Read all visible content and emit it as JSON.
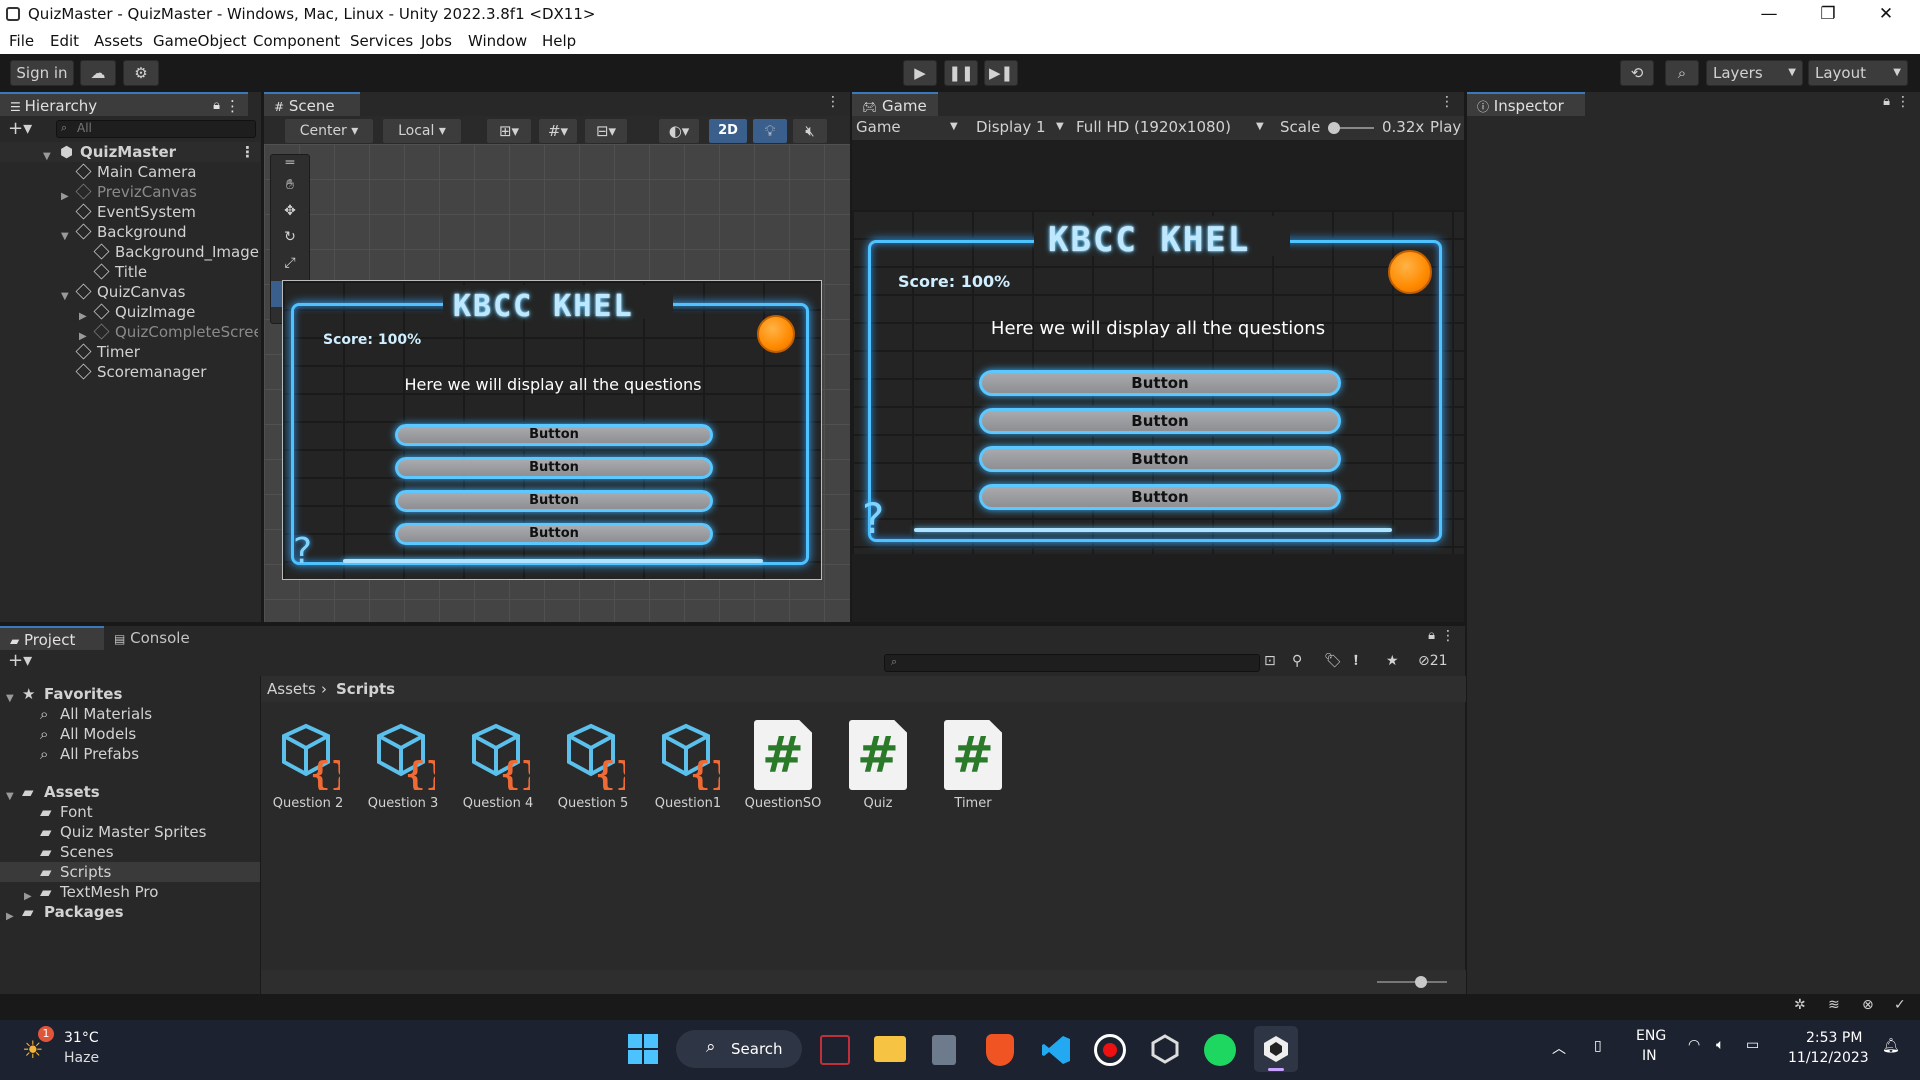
{
  "window": {
    "title": "QuizMaster - QuizMaster - Windows, Mac, Linux - Unity 2022.3.8f1 <DX11>",
    "minimize": "—",
    "restore": "❐",
    "close": "✕"
  },
  "menu": [
    "File",
    "Edit",
    "Assets",
    "GameObject",
    "Component",
    "Services",
    "Jobs",
    "Window",
    "Help"
  ],
  "toolbar": {
    "sign_in": "Sign in",
    "layers": "Layers",
    "layout": "Layout"
  },
  "hierarchy": {
    "tab": "Hierarchy",
    "search_placeholder": "All",
    "scene": "QuizMaster",
    "items": [
      {
        "label": "Main Camera"
      },
      {
        "label": "PrevizCanvas"
      },
      {
        "label": "EventSystem"
      },
      {
        "label": "Background"
      },
      {
        "label": "Background_Image"
      },
      {
        "label": "Title"
      },
      {
        "label": "QuizCanvas"
      },
      {
        "label": "QuizImage"
      },
      {
        "label": "QuizCompleteScree"
      },
      {
        "label": "Timer"
      },
      {
        "label": "Scoremanager"
      }
    ]
  },
  "scene": {
    "tab": "Scene",
    "pivot": "Center",
    "space": "Local",
    "mode2d": "2D"
  },
  "game": {
    "tab": "Game",
    "view": "Game",
    "display": "Display 1",
    "resolution": "Full HD (1920x1080)",
    "scale_label": "Scale",
    "scale_value": "0.32x",
    "play_label": "Play",
    "title": "KBCC KHEL",
    "score": "Score: 100%",
    "question": "Here we will display all the questions",
    "buttons": [
      "Button",
      "Button",
      "Button",
      "Button"
    ],
    "question_mark": "?"
  },
  "inspector": {
    "tab": "Inspector"
  },
  "project": {
    "tab_project": "Project",
    "tab_console": "Console",
    "hidden_count": "21",
    "favorites": "Favorites",
    "fav_items": [
      "All Materials",
      "All Models",
      "All Prefabs"
    ],
    "assets": "Assets",
    "asset_folders": [
      "Font",
      "Quiz Master Sprites",
      "Scenes",
      "Scripts",
      "TextMesh Pro"
    ],
    "packages": "Packages",
    "breadcrumb_root": "Assets",
    "breadcrumb_sep": "›",
    "breadcrumb_current": "Scripts",
    "files": [
      {
        "name": "Question 2",
        "kind": "scriptable-object-icon"
      },
      {
        "name": "Question 3",
        "kind": "scriptable-object-icon"
      },
      {
        "name": "Question 4",
        "kind": "scriptable-object-icon"
      },
      {
        "name": "Question 5",
        "kind": "scriptable-object-icon"
      },
      {
        "name": "Question1",
        "kind": "scriptable-object-icon"
      },
      {
        "name": "QuestionSO",
        "kind": "csharp-script-icon"
      },
      {
        "name": "Quiz",
        "kind": "csharp-script-icon"
      },
      {
        "name": "Timer",
        "kind": "csharp-script-icon"
      }
    ]
  },
  "taskbar": {
    "temp": "31°C",
    "weather": "Haze",
    "weather_badge": "1",
    "search": "Search",
    "lang1": "ENG",
    "lang2": "IN",
    "time": "2:53 PM",
    "date": "11/12/2023"
  },
  "colors": {
    "accent": "#3a79bb",
    "neon": "#4fc3ff",
    "orb": "#ff8a00"
  }
}
